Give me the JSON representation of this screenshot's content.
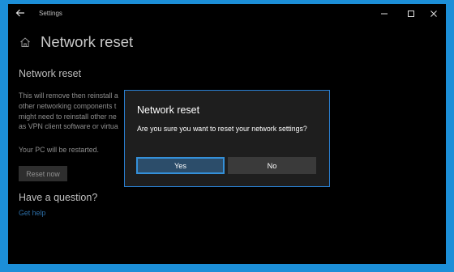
{
  "window": {
    "title": "Settings",
    "back_icon": "back-arrow-icon",
    "controls": [
      "minimize-icon",
      "maximize-icon",
      "close-icon"
    ]
  },
  "page": {
    "home_icon": "home-icon",
    "title": "Network reset",
    "section_title": "Network reset",
    "description_lines": [
      "This will remove then reinstall a",
      "other networking components t",
      "might need to reinstall other ne",
      "as VPN client software or virtua"
    ],
    "restart_note": "Your PC will be restarted.",
    "reset_button": "Reset now",
    "question_heading": "Have a question?",
    "help_link": "Get help"
  },
  "dialog": {
    "title": "Network reset",
    "message": "Are you sure you want to reset your network settings?",
    "yes_label": "Yes",
    "no_label": "No"
  },
  "colors": {
    "desktop": "#1c8fd8",
    "window_bg": "#000000",
    "dialog_bg": "#1e1e1e",
    "dialog_border": "#2a7fd0",
    "link": "#2d6fa8",
    "focus": "#3490d9"
  }
}
